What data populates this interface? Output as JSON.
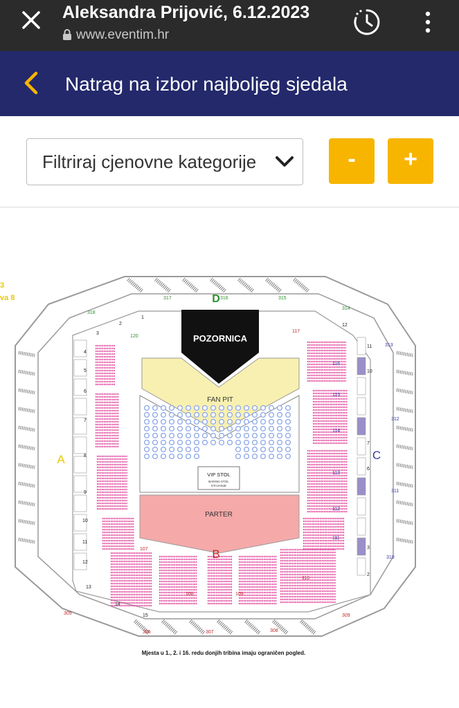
{
  "browser": {
    "title": "Aleksandra Prijović, 6.12.2023",
    "url": "www.eventim.hr",
    "icons": [
      "close-icon",
      "lock-icon",
      "timer-icon",
      "more-vert-icon"
    ]
  },
  "nav": {
    "back_label": "Natrag na izbor najboljeg sjedala",
    "accent": "#f7b500",
    "background": "#23296b"
  },
  "filter": {
    "value": "Filtriraj cjenovne kategorije",
    "zoom_out": "-",
    "zoom_in": "+"
  },
  "seatmap": {
    "stage": "POZORNICA",
    "fan_pit": "FAN PIT",
    "vip": "VIP STOL",
    "vip_sub1": "BARSKI STOL",
    "vip_sub2": "STAJANJE",
    "parter": "PARTER",
    "side_a": "A",
    "side_b": "B",
    "side_c": "C",
    "side_d": "D",
    "left_edge_top": "3",
    "left_edge_bottom": "va 8",
    "outer_sections": [
      "317",
      "316",
      "315",
      "314",
      "318",
      "313",
      "312",
      "311",
      "310",
      "309",
      "308",
      "307",
      "306",
      "305"
    ],
    "inner_sections": [
      "116",
      "115",
      "114",
      "113",
      "112",
      "111",
      "110",
      "109",
      "108",
      "107",
      "117",
      "120"
    ],
    "box_numbers_left": [
      "4",
      "5",
      "6",
      "7",
      "8",
      "9",
      "10",
      "11",
      "12",
      "13",
      "14",
      "15"
    ],
    "box_numbers_right": [
      "11",
      "10",
      "7",
      "6",
      "3",
      "2"
    ],
    "box_numbers_top": [
      "1",
      "2",
      "3",
      "12"
    ],
    "footnote": "Mjesta u 1., 2. i 16. redu donjih tribina imaju ograničen pogled.",
    "colors": {
      "stage": "#111111",
      "fan_pit": "#f8f0b0",
      "parter": "#f5a9a9",
      "vip_tables": "#8aa6e6",
      "seats_pink": "#e0409a",
      "seats_grey": "#7a7a7a",
      "label_red": "#c0282c",
      "label_green": "#2f8f2f",
      "label_blue": "#3a3aa0",
      "label_yellow": "#e8c800"
    }
  }
}
